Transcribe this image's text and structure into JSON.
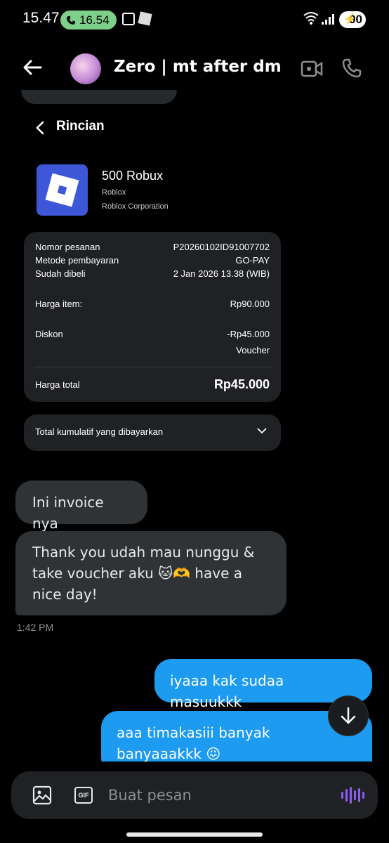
{
  "status_bar": {
    "time": "15.47",
    "call_time": "16.54",
    "battery": "90"
  },
  "header": {
    "chat_name": "Zero | mt after dm"
  },
  "receipt": {
    "title": "Rincian",
    "app_name": "500 Robux",
    "developer": "Roblox",
    "corporation": "Roblox Corporation",
    "rows": [
      {
        "label": "Nomor pesanan",
        "value": "P20260102ID91007702"
      },
      {
        "label": "Metode pembayaran",
        "value": "GO-PAY"
      },
      {
        "label": "Sudah dibeli",
        "value": "2 Jan 2026 13.38 (WIB)"
      }
    ],
    "harga_item_label": "Harga item:",
    "harga_item_value": "Rp90.000",
    "diskon_label": "Diskon",
    "diskon_value": "-Rp45.000",
    "diskon_note": "Voucher",
    "total_label": "Harga total",
    "total_value": "Rp45.000",
    "cumulative_label": "Total kumulatif yang dibayarkan"
  },
  "messages": {
    "m1": "Ini invoice nya",
    "m2": "Thank you udah mau nunggu & take voucher aku 🐱🫶 have a nice day!",
    "timestamp": "1:42 PM",
    "m3": "iyaaa kak sudaa masuukkk",
    "m4": "aaa timakasiii banyak banyaaakkk 😖"
  },
  "composer": {
    "placeholder": "Buat pesan",
    "gif_label": "GIF"
  }
}
